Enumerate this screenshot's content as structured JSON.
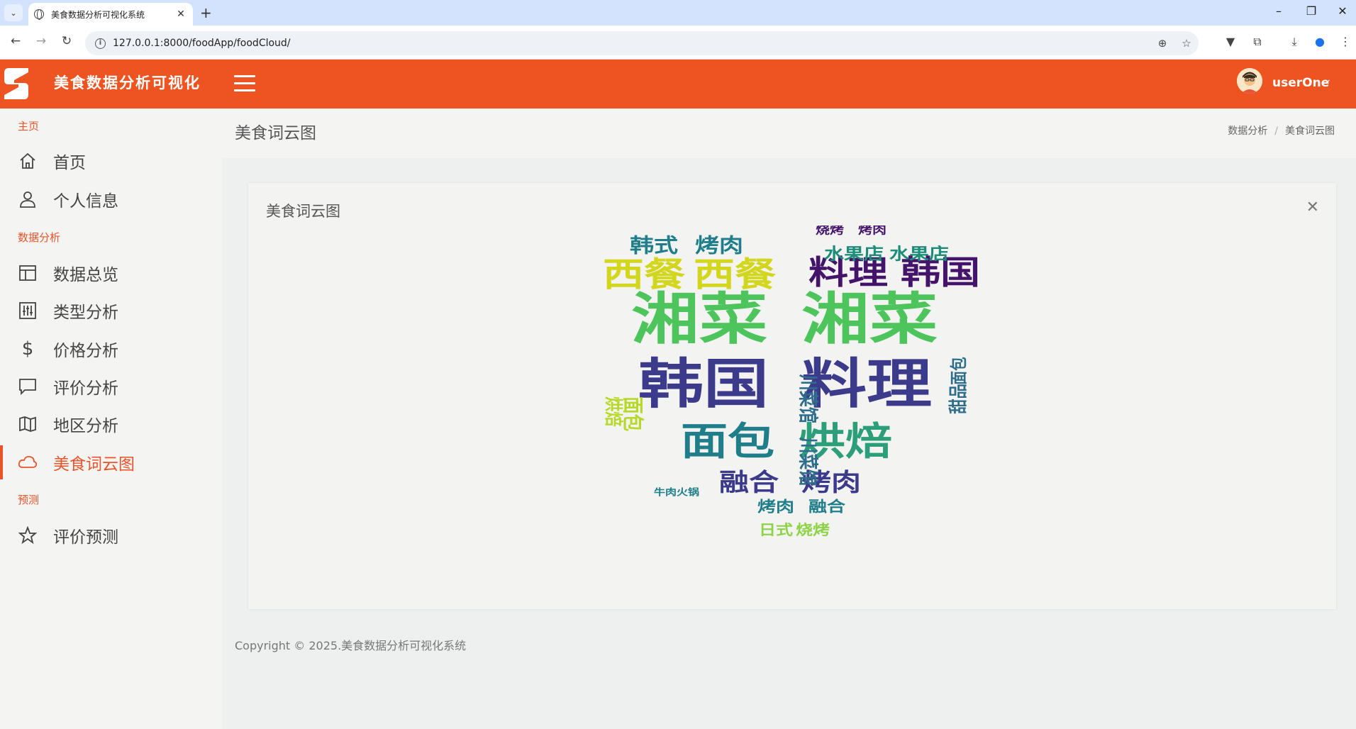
{
  "browser": {
    "tab_title": "美食数据分析可视化系统",
    "url": "127.0.0.1:8000/foodApp/foodCloud/"
  },
  "header": {
    "brand": "美食数据分析可视化",
    "user_name": "userOne",
    "accent_color": "#ee5422"
  },
  "sidebar": {
    "sections": [
      {
        "label": "主页"
      },
      {
        "label": "数据分析"
      },
      {
        "label": "预测"
      }
    ],
    "items": [
      {
        "label": "首页",
        "icon": "home-icon"
      },
      {
        "label": "个人信息",
        "icon": "user-icon"
      },
      {
        "label": "数据总览",
        "icon": "layout-icon"
      },
      {
        "label": "类型分析",
        "icon": "sliders-icon"
      },
      {
        "label": "价格分析",
        "icon": "dollar-icon"
      },
      {
        "label": "评价分析",
        "icon": "message-icon"
      },
      {
        "label": "地区分析",
        "icon": "map-icon"
      },
      {
        "label": "美食词云图",
        "icon": "cloud-icon",
        "active": true
      },
      {
        "label": "评价预测",
        "icon": "star-icon"
      }
    ]
  },
  "page": {
    "title": "美食词云图",
    "breadcrumb": [
      "数据分析",
      "美食词云图"
    ]
  },
  "card": {
    "title": "美食词云图",
    "wordcloud_words": [
      {
        "text": "湘菜",
        "color": "#4ec45c"
      },
      {
        "text": "湘菜",
        "color": "#4ec45c"
      },
      {
        "text": "韩国",
        "color": "#3c3a8a"
      },
      {
        "text": "料理",
        "color": "#3c3a8a"
      },
      {
        "text": "面包",
        "color": "#1f7e8a"
      },
      {
        "text": "烘焙",
        "color": "#2d9e7a"
      },
      {
        "text": "西餐",
        "color": "#d2d61c"
      },
      {
        "text": "西餐",
        "color": "#d2d61c"
      },
      {
        "text": "料理",
        "color": "#43146a"
      },
      {
        "text": "韩国",
        "color": "#43146a"
      },
      {
        "text": "韩式",
        "color": "#1f7e8a"
      },
      {
        "text": "烤肉",
        "color": "#1f7e8a"
      },
      {
        "text": "水果店",
        "color": "#1d8c78"
      },
      {
        "text": "水果店",
        "color": "#1d8c78"
      },
      {
        "text": "融合",
        "color": "#3c3a8a"
      },
      {
        "text": "烤肉",
        "color": "#3c3a8a"
      },
      {
        "text": "烤肉",
        "color": "#1f7e8a"
      },
      {
        "text": "融合",
        "color": "#1f7e8a"
      },
      {
        "text": "日式",
        "color": "#8ed24a"
      },
      {
        "text": "烧烤",
        "color": "#8ed24a"
      },
      {
        "text": "川菜馆",
        "color": "#2e6e8c"
      },
      {
        "text": "川菜馆",
        "color": "#2e6e8c"
      },
      {
        "text": "烧烤",
        "color": "#43146a"
      },
      {
        "text": "烤肉",
        "color": "#43146a"
      },
      {
        "text": "烘焙",
        "color": "#b8d829"
      },
      {
        "text": "面包",
        "color": "#b8d829"
      },
      {
        "text": "甜品",
        "color": "#2e6e8c"
      },
      {
        "text": "面包",
        "color": "#2e6e8c"
      },
      {
        "text": "牛肉",
        "color": "#1f7e8a"
      },
      {
        "text": "火锅",
        "color": "#1f7e8a"
      }
    ]
  },
  "footer": {
    "copyright": "Copyright © 2025.美食数据分析可视化系统"
  }
}
